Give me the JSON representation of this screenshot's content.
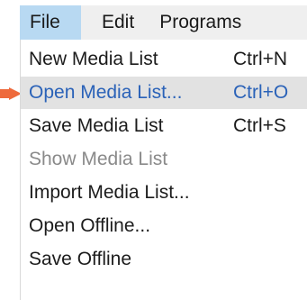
{
  "menubar": {
    "items": [
      {
        "label": "File"
      },
      {
        "label": "Edit"
      },
      {
        "label": "Programs"
      }
    ]
  },
  "file_menu": {
    "items": [
      {
        "label": "New Media List",
        "shortcut": "Ctrl+N",
        "state": "normal"
      },
      {
        "label": "Open Media List...",
        "shortcut": "Ctrl+O",
        "state": "selected"
      },
      {
        "label": "Save Media List",
        "shortcut": "Ctrl+S",
        "state": "normal"
      },
      {
        "label": "Show Media List",
        "shortcut": "",
        "state": "disabled"
      },
      {
        "label": "Import Media List...",
        "shortcut": "",
        "state": "normal"
      },
      {
        "label": "Open Offline...",
        "shortcut": "",
        "state": "normal"
      },
      {
        "label": "Save Offline",
        "shortcut": "",
        "state": "normal"
      }
    ]
  },
  "colors": {
    "menubar_bg": "#efefef",
    "active_menu_bg": "#b8d9f2",
    "selected_item_bg": "#e2e2e2",
    "selected_item_text": "#2a62b8",
    "disabled_text": "#8a8a8a",
    "pointer_arrow": "#ee6a3c"
  },
  "icons": {
    "pointer": "arrow-pointer-icon"
  }
}
